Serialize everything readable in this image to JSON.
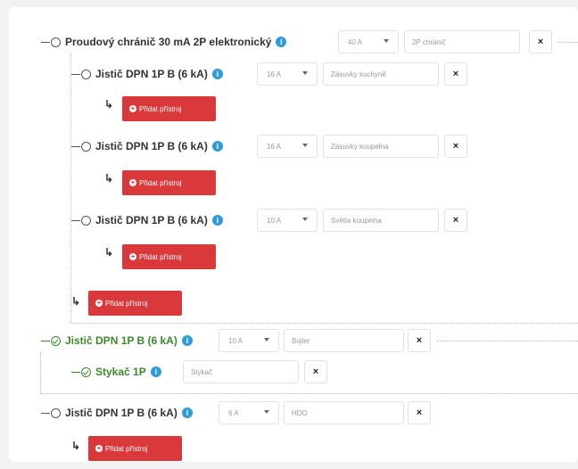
{
  "info_glyph": "i",
  "remove_glyph": "×",
  "add_arrow_glyph": "↳",
  "plus_glyph": "+",
  "colors": {
    "add_button": "#d9393b",
    "info": "#2f9bd8",
    "active_green": "#3a8a2a"
  },
  "tree": {
    "rcd": {
      "label": "Proudový chránič 30 mA 2P elektronický",
      "rating": "40 A",
      "name": "2P chránič"
    },
    "b1": {
      "label": "Jistič DPN 1P B (6 kA)",
      "rating": "16 A",
      "name": "Zásuvky kuchyně"
    },
    "b2": {
      "label": "Jistič DPN 1P B (6 kA)",
      "rating": "16 A",
      "name": "Zásuvky koupelna"
    },
    "b3": {
      "label": "Jistič DPN 1P B (6 kA)",
      "rating": "10 A",
      "name": "Světla koupelna"
    },
    "b4": {
      "label": "Jistič DPN 1P B (6 kA)",
      "rating": "10 A",
      "name": "Bojler"
    },
    "contactor": {
      "label": "Stykač 1P",
      "name": "Stykač"
    },
    "b5": {
      "label": "Jistič DPN 1P B (6 kA)",
      "rating": "6 A",
      "name": "HDO"
    }
  },
  "add_button_label": "Přidat přístroj"
}
